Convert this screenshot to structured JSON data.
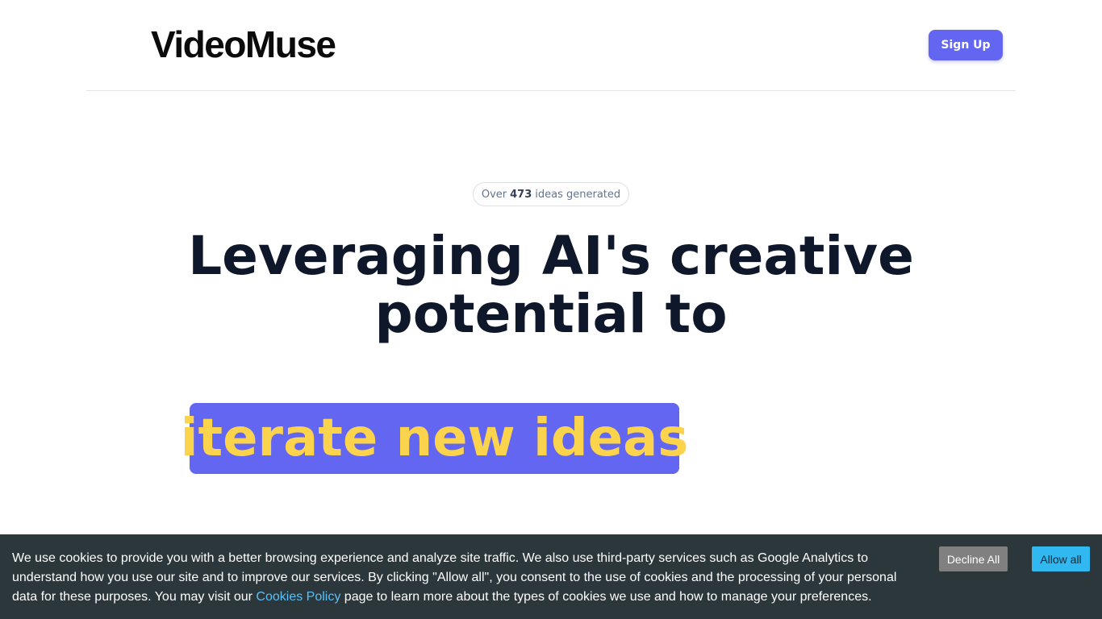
{
  "header": {
    "logo": "VideoMuse",
    "signup_label": "Sign Up"
  },
  "hero": {
    "counter_prefix": "Over",
    "counter_value": "473",
    "counter_suffix": "ideas generated",
    "title_line1": "Leveraging AI's creative",
    "title_line2": "potential to",
    "highlight": "iterate new ideas"
  },
  "cookie_banner": {
    "text_part1": "We use cookies to provide you with a better browsing experience and analyze site traffic. We also use third-party services such as Google Analytics to understand how you use our site and to improve our services. By clicking \"Allow all\", you consent to the use of cookies and the processing of your personal data for these purposes. You may visit our",
    "policy_link": "Cookies Policy",
    "text_part2": "page to learn more about the types of cookies we use and how to manage your preferences.",
    "decline_label": "Decline All",
    "allow_label": "Allow all"
  },
  "colors": {
    "accent": "#6366f1",
    "highlight_text": "#fcd34d",
    "cookie_bg": "#2b373b",
    "allow_btn": "#32b8f0",
    "decline_btn": "#808080"
  }
}
